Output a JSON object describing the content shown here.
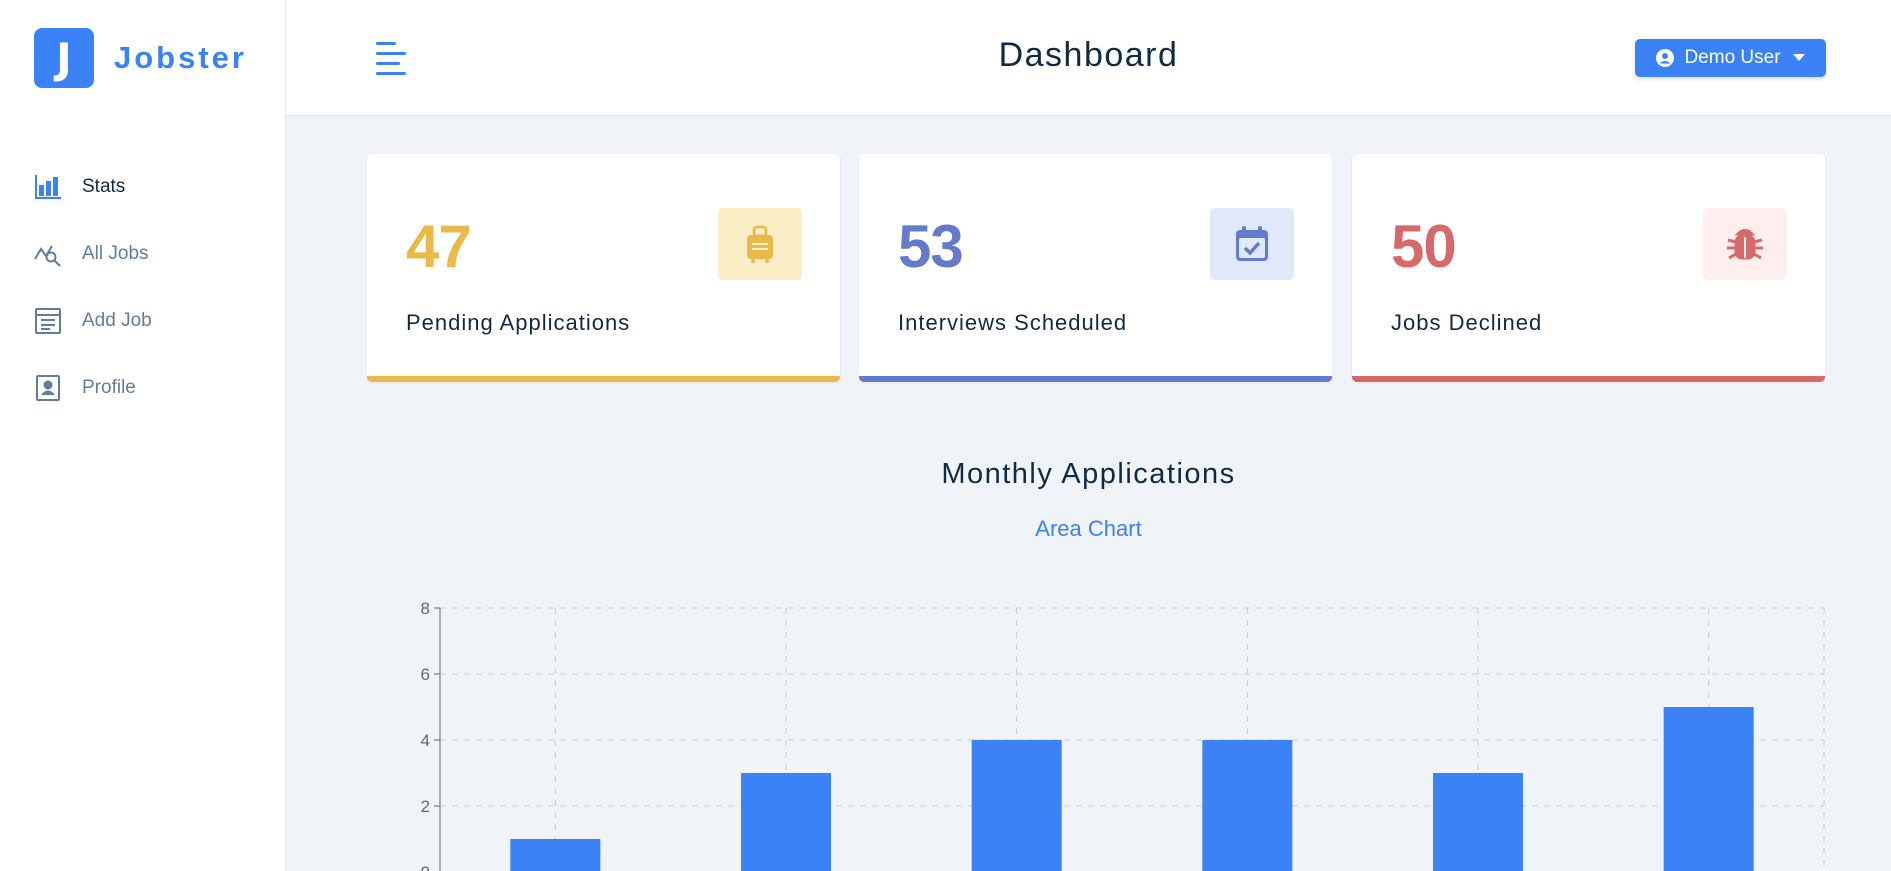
{
  "brand": {
    "logo_letter": "J",
    "name": "Jobster",
    "accent": "#3b82f6"
  },
  "sidebar": {
    "items": [
      {
        "label": "Stats",
        "icon": "bar-chart-icon",
        "active": true
      },
      {
        "label": "All Jobs",
        "icon": "search-chart-icon",
        "active": false
      },
      {
        "label": "Add Job",
        "icon": "form-icon",
        "active": false
      },
      {
        "label": "Profile",
        "icon": "id-card-icon",
        "active": false
      }
    ]
  },
  "header": {
    "title": "Dashboard",
    "menu_icon": "hamburger-icon",
    "user_label": "Demo User",
    "user_icon": "user-circle-icon",
    "dropdown_icon": "caret-down-icon"
  },
  "stats": [
    {
      "count": "47",
      "label": "Pending Applications",
      "icon": "suitcase-icon",
      "color": "#e9b949",
      "bg": "#fcefc7"
    },
    {
      "count": "53",
      "label": "Interviews Scheduled",
      "icon": "calendar-check-icon",
      "color": "#647acb",
      "bg": "#e0e8f9"
    },
    {
      "count": "50",
      "label": "Jobs Declined",
      "icon": "bug-icon",
      "color": "#d66a6a",
      "bg": "#ffeeee"
    }
  ],
  "chart_section": {
    "title": "Monthly Applications",
    "toggle_label": "Area Chart"
  },
  "chart_data": {
    "type": "bar",
    "categories": [
      "",
      "",
      "",
      "",
      "",
      ""
    ],
    "values": [
      1,
      3,
      4,
      4,
      3,
      5
    ],
    "ylim": [
      0,
      8
    ],
    "yticks": [
      0,
      2,
      4,
      6,
      8
    ],
    "grid": true,
    "bar_color": "#3b82f6"
  }
}
